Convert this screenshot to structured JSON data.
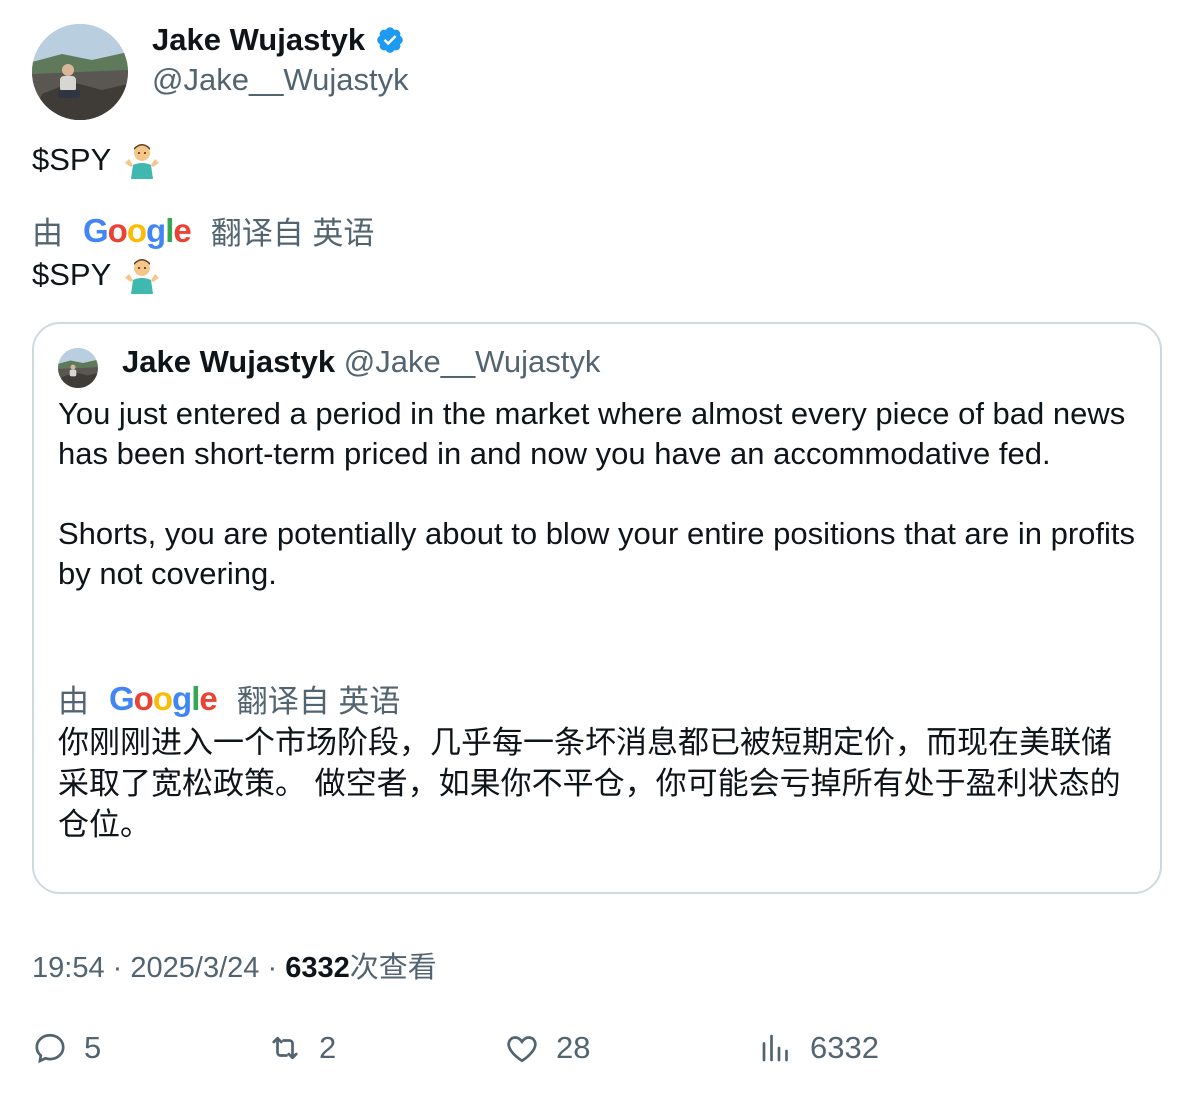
{
  "author": {
    "name": "Jake Wujastyk",
    "handle": "@Jake__Wujastyk",
    "verified_icon": "verified-badge-icon"
  },
  "tweet": {
    "text": "$SPY",
    "emoji": "person-shrugging",
    "translation_prefix": "由",
    "translation_brand": "Google",
    "translation_suffix": "翻译自 英语",
    "translated_text": "$SPY"
  },
  "quote": {
    "name": "Jake Wujastyk",
    "handle": "@Jake__Wujastyk",
    "paragraph1": "You just entered a period in the market where almost every piece of bad news has been short-term priced in and now you have an accommodative fed.",
    "paragraph2": "Shorts, you are potentially about to blow your entire positions that are in profits by not covering.",
    "translation_prefix": "由",
    "translation_brand": "Google",
    "translation_suffix": "翻译自 英语",
    "translated_text": "你刚刚进入一个市场阶段，几乎每一条坏消息都已被短期定价，而现在美联储采取了宽松政策。 做空者，如果你不平仓，你可能会亏掉所有处于盈利状态的仓位。"
  },
  "meta": {
    "time": "19:54",
    "separator": "·",
    "date": "2025/3/24",
    "views_count": "6332",
    "views_label": "次查看"
  },
  "actions": {
    "replies": "5",
    "retweets": "2",
    "likes": "28",
    "views": "6332"
  },
  "colors": {
    "verified": "#1d9bf0",
    "secondary_text": "#536471",
    "border": "#cfd9de"
  }
}
